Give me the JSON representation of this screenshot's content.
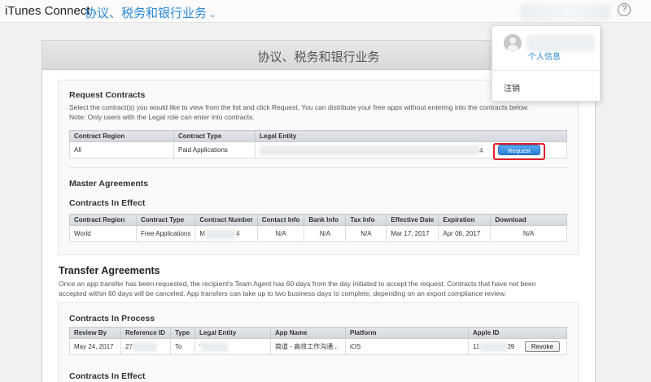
{
  "topbar": {
    "brand": "iTunes Connect",
    "section": "协议、税务和银行业务"
  },
  "dropdown": {
    "profile_label": "个人信息",
    "signout_label": "注销"
  },
  "panel": {
    "title": "协议、税务和银行业务"
  },
  "request_contracts": {
    "heading": "Request Contracts",
    "desc_line1": "Select the contract(s) you would like to view from the list and click Request. You can distribute your free apps without entering into the contracts below.",
    "desc_line2": "Note: Only users with the Legal role can enter into contracts.",
    "headers": [
      "Contract Region",
      "Contract Type",
      "Legal Entity"
    ],
    "row": {
      "region": "All",
      "type": "Paid Applications",
      "entity_tail": "4"
    },
    "request_label": "Request"
  },
  "master": {
    "heading": "Master Agreements",
    "sub": "Contracts In Effect",
    "headers": [
      "Contract Region",
      "Contract Type",
      "Contract Number",
      "Contact Info",
      "Bank Info",
      "Tax Info",
      "Effective Date",
      "Expiration",
      "Download"
    ],
    "row": {
      "region": "World",
      "type": "Free Applications",
      "number_prefix": "M",
      "number_suffix": "4",
      "contact": "N/A",
      "bank": "N/A",
      "tax": "N/A",
      "effective": "Mar 17, 2017",
      "expiration": "Apr 06, 2017",
      "download": "N/A"
    }
  },
  "transfer": {
    "heading": "Transfer Agreements",
    "desc_line1": "Once an app transfer has been requested, the recipient's Team Agent has 60 days from the day initiated to accept the request. Contracts that have not been",
    "desc_line2": "accepted within 60 days will be canceled. App transfers can take up to two business days to complete, depending on an export compliance review.",
    "in_process": "Contracts In Process",
    "headers": [
      "Review By",
      "Reference ID",
      "Type",
      "Legal Entity",
      "App Name",
      "Platform",
      "Apple ID"
    ],
    "row": {
      "review_by": "May 24, 2017",
      "ref_prefix": "27",
      "type": "To",
      "entity_prefix": "'",
      "app_name": "简道 - 高效工作沟通...",
      "platform": "iOS",
      "apple_id_prefix": "11",
      "apple_id_suffix": "39"
    },
    "revoke_label": "Revoke",
    "in_effect": "Contracts In Effect"
  }
}
